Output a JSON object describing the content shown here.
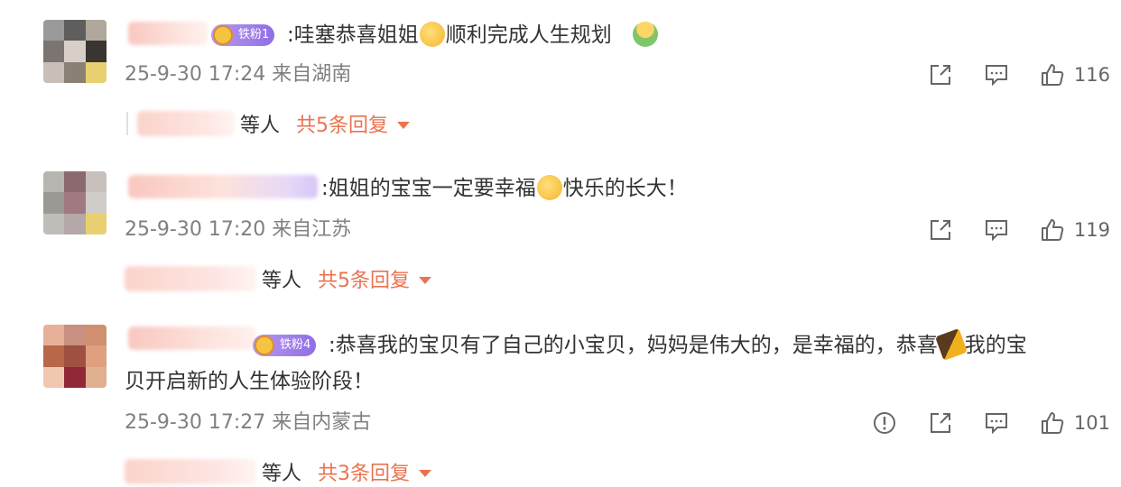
{
  "comments": [
    {
      "badge": "铁粉1",
      "text_a": ":哇塞恭喜姐姐",
      "text_b": "顺利完成人生规划",
      "date": "25-9-30 17:24 来自湖南",
      "likes": "116",
      "reply_who": "等人",
      "reply_count": "共5条回复"
    },
    {
      "text_a": ":姐姐的宝宝一定要幸福",
      "text_b": "快乐的长大！",
      "date": "25-9-30 17:20 来自江苏",
      "likes": "119",
      "reply_who": "等人",
      "reply_count": "共5条回复"
    },
    {
      "badge": "铁粉4",
      "text_a": ":恭喜我的宝贝有了自己的小宝贝，妈妈是伟大的，是幸福的，恭喜",
      "text_b": "我的宝",
      "text_c": "贝开启新的人生体验阶段！",
      "date": "25-9-30 17:27 来自内蒙古",
      "likes": "101",
      "reply_who": "等人",
      "reply_count": "共3条回复"
    }
  ],
  "colors": {
    "accent": "#eb7350",
    "meta": "#808080",
    "text": "#333333"
  },
  "icons": [
    "share-icon",
    "comment-icon",
    "like-icon",
    "report-icon",
    "caret-down-icon"
  ]
}
